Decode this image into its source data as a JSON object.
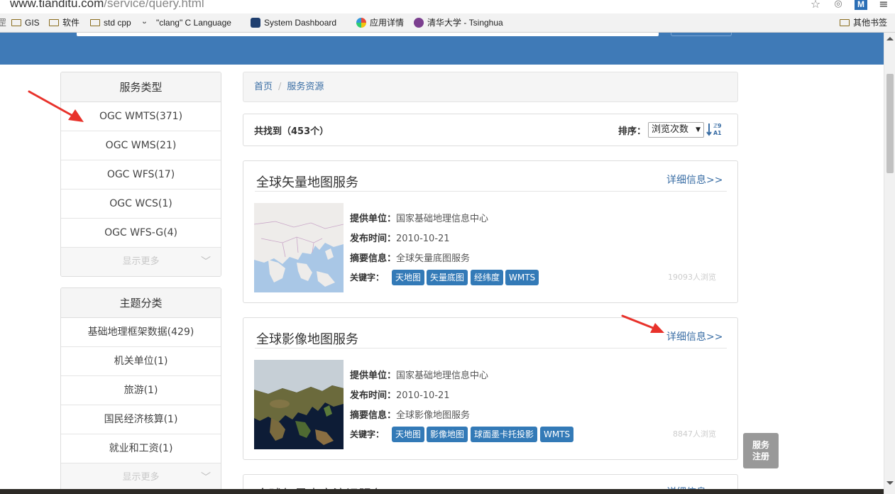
{
  "browser": {
    "url_host": "www.tianditu.com",
    "url_path": "/service/query.html",
    "bookmarks": [
      {
        "label": "GIS",
        "icon": "folder-icon"
      },
      {
        "label": "软件",
        "icon": "folder-icon"
      },
      {
        "label": "std cpp",
        "icon": "folder-icon"
      },
      {
        "label": "\"clang\" C Language",
        "icon": "clang-icon"
      },
      {
        "label": "System Dashboard",
        "icon": "dashboard-icon"
      },
      {
        "label": "应用详情",
        "icon": "app-icon"
      },
      {
        "label": "清华大学 - Tsinghua",
        "icon": "tsinghua-icon"
      },
      {
        "label": "其他书签",
        "icon": "folder-icon"
      }
    ],
    "extension_label": "M"
  },
  "sidebar": {
    "service_types": {
      "title": "服务类型",
      "items": [
        "OGC WMTS(371)",
        "OGC WMS(21)",
        "OGC WFS(17)",
        "OGC WCS(1)",
        "OGC WFS-G(4)"
      ],
      "more": "显示更多"
    },
    "topics": {
      "title": "主题分类",
      "items": [
        "基础地理框架数据(429)",
        "机关单位(1)",
        "旅游(1)",
        "国民经济核算(1)",
        "就业和工资(1)"
      ],
      "more": "显示更多"
    }
  },
  "breadcrumb": {
    "home": "首页",
    "sep": "/",
    "current": "服务资源"
  },
  "results": {
    "found": "共找到（453个）",
    "sort_label": "排序：",
    "sort_value": "浏览次数",
    "items": [
      {
        "title": "全球矢量地图服务",
        "detail": "详细信息>>",
        "provider_label": "提供单位：",
        "provider": "国家基础地理信息中心",
        "date_label": "发布时间：",
        "date": "2010-10-21",
        "summary_label": "摘要信息：",
        "summary": "全球矢量底图服务",
        "keywords_label": "关键字：",
        "keywords": [
          "天地图",
          "矢量底图",
          "经纬度",
          "WMTS"
        ],
        "views": "19093人浏览"
      },
      {
        "title": "全球影像地图服务",
        "detail": "详细信息>>",
        "provider_label": "提供单位：",
        "provider": "国家基础地理信息中心",
        "date_label": "发布时间：",
        "date": "2010-10-21",
        "summary_label": "摘要信息：",
        "summary": "全球影像地图服务",
        "keywords_label": "关键字：",
        "keywords": [
          "天地图",
          "影像地图",
          "球面墨卡托投影",
          "WMTS"
        ],
        "views": "8847人浏览"
      }
    ],
    "partial_title": "全球矢量中文注记服务",
    "partial_detail": "详细信息>>"
  },
  "float_button": {
    "line1": "服务",
    "line2": "注册"
  },
  "colors": {
    "header": "#3f7ab7",
    "tag": "#337ab7",
    "link": "#3a6ea5",
    "arrow": "#e8322b"
  }
}
